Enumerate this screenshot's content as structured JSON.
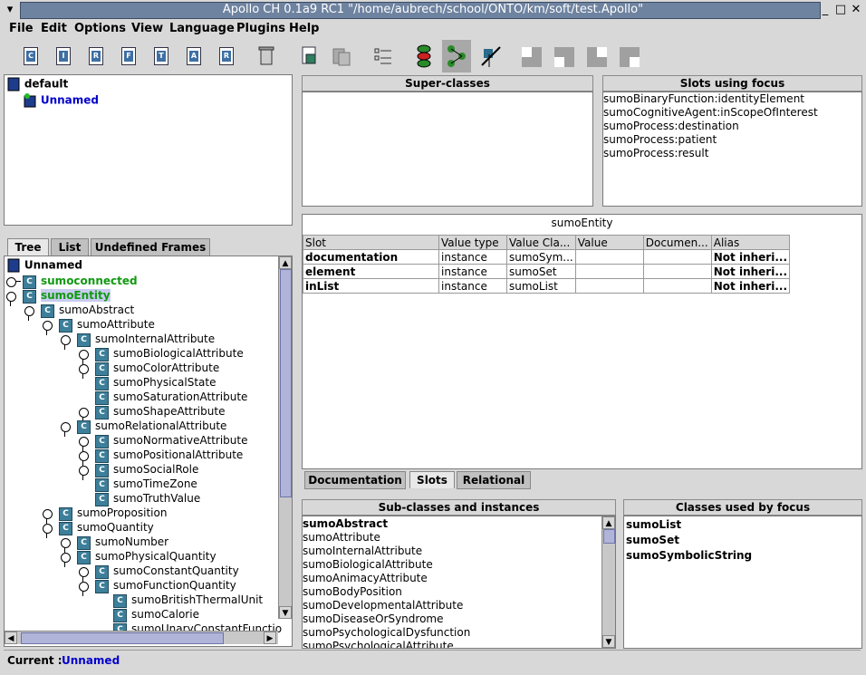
{
  "window": {
    "title": "Apollo CH 0.1a9 RC1 \"/home/aubrech/school/ONTO/km/soft/test.Apollo\"",
    "minimize": "_",
    "maximize": "□",
    "close": "✕"
  },
  "menu": [
    "File",
    "Edit",
    "Options",
    "View",
    "Language",
    "Plugins",
    "Help"
  ],
  "toolbar": {
    "doc_letters": [
      "C",
      "I",
      "R",
      "F",
      "T",
      "A",
      "R"
    ]
  },
  "ontology_tree": {
    "root": "default",
    "child": "Unnamed"
  },
  "tabs": {
    "tree": "Tree",
    "list": "List",
    "undefined": "Undefined Frames"
  },
  "class_tree": {
    "root": "Unnamed",
    "items": [
      {
        "label": "sumoconnected",
        "depth": 0
      },
      {
        "label": "sumoEntity",
        "depth": 0
      },
      {
        "label": "sumoAbstract",
        "depth": 1
      },
      {
        "label": "sumoAttribute",
        "depth": 2
      },
      {
        "label": "sumoInternalAttribute",
        "depth": 3
      },
      {
        "label": "sumoBiologicalAttribute",
        "depth": 4
      },
      {
        "label": "sumoColorAttribute",
        "depth": 4
      },
      {
        "label": "sumoPhysicalState",
        "depth": 4
      },
      {
        "label": "sumoSaturationAttribute",
        "depth": 4
      },
      {
        "label": "sumoShapeAttribute",
        "depth": 4
      },
      {
        "label": "sumoRelationalAttribute",
        "depth": 3
      },
      {
        "label": "sumoNormativeAttribute",
        "depth": 4
      },
      {
        "label": "sumoPositionalAttribute",
        "depth": 4
      },
      {
        "label": "sumoSocialRole",
        "depth": 4
      },
      {
        "label": "sumoTimeZone",
        "depth": 4
      },
      {
        "label": "sumoTruthValue",
        "depth": 4
      },
      {
        "label": "sumoProposition",
        "depth": 2
      },
      {
        "label": "sumoQuantity",
        "depth": 2
      },
      {
        "label": "sumoNumber",
        "depth": 3
      },
      {
        "label": "sumoPhysicalQuantity",
        "depth": 3
      },
      {
        "label": "sumoConstantQuantity",
        "depth": 4
      },
      {
        "label": "sumoFunctionQuantity",
        "depth": 4
      },
      {
        "label": "sumoBritishThermalUnit",
        "depth": 5
      },
      {
        "label": "sumoCalorie",
        "depth": 5
      },
      {
        "label": "sumoUnaryConstantFunctio",
        "depth": 5
      }
    ]
  },
  "superclasses": {
    "header": "Super-classes"
  },
  "slots_using_focus": {
    "header": "Slots using focus",
    "items": [
      "sumoBinaryFunction:identityElement",
      "sumoCognitiveAgent:inScopeOfInterest",
      "sumoProcess:destination",
      "sumoProcess:patient",
      "sumoProcess:result"
    ]
  },
  "focus_title": "sumoEntity",
  "slot_table": {
    "columns": [
      "Slot",
      "Value type",
      "Value Cla...",
      "Value",
      "Documen...",
      "Alias"
    ],
    "rows": [
      [
        "documentation",
        "instance",
        "sumoSym...",
        "",
        "",
        "Not inheri..."
      ],
      [
        "element",
        "instance",
        "sumoSet",
        "",
        "",
        "Not inheri..."
      ],
      [
        "inList",
        "instance",
        "sumoList",
        "",
        "",
        "Not inheri..."
      ]
    ]
  },
  "center_tabs": {
    "documentation": "Documentation",
    "slots": "Slots",
    "relational": "Relational"
  },
  "subclasses": {
    "header": "Sub-classes and instances",
    "items": [
      "sumoAbstract",
      "sumoAttribute",
      "sumoInternalAttribute",
      "sumoBiologicalAttribute",
      "sumoAnimacyAttribute",
      "sumoBodyPosition",
      "sumoDevelopmentalAttribute",
      "sumoDiseaseOrSyndrome",
      "sumoPsychologicalDysfunction",
      "sumoPsychologicalAttribute"
    ]
  },
  "classes_used": {
    "header": "Classes used by focus",
    "items": [
      "sumoList",
      "sumoSet",
      "sumoSymbolicString"
    ]
  },
  "status": {
    "label": "Current :",
    "value": "Unnamed"
  },
  "colors": {
    "title_bar": "#6e83a0",
    "link_blue": "#0000cc",
    "green": "#119911",
    "selection": "#c8ccef"
  }
}
